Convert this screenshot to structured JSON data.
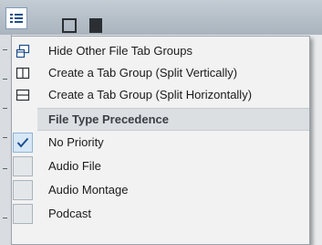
{
  "menu_button": {
    "icon": "list-menu-icon"
  },
  "menu": {
    "items": [
      {
        "icon": "tab-group-icon",
        "label": "Hide Other File Tab Groups"
      },
      {
        "icon": "split-vertical-icon",
        "label": "Create a Tab Group (Split Vertically)"
      },
      {
        "icon": "split-horizontal-icon",
        "label": "Create a Tab Group (Split Horizontally)"
      }
    ],
    "section_header": "File Type Precedence",
    "options": [
      {
        "label": "No Priority",
        "checked": true,
        "icon": "checkmark-icon"
      },
      {
        "label": "Audio File",
        "checked": false
      },
      {
        "label": "Audio Montage",
        "checked": false
      },
      {
        "label": "Podcast",
        "checked": false
      }
    ]
  },
  "colors": {
    "accent": "#1e4f8c",
    "menu_background": "#f2f2f2",
    "section_background": "#dcdfe2"
  }
}
